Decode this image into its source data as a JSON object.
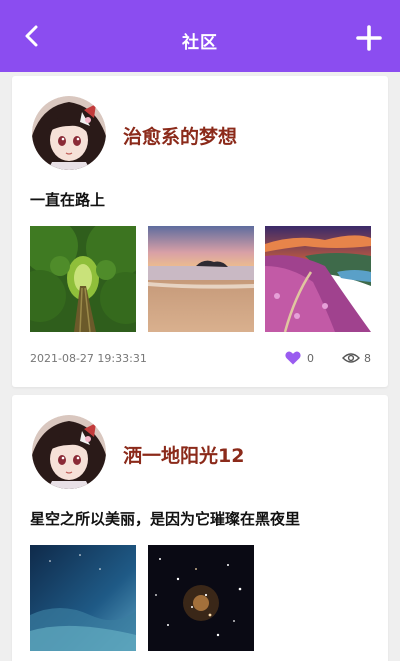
{
  "header": {
    "title": "社区",
    "back_icon": "chevron-left-icon",
    "add_icon": "plus-icon",
    "background_color": "#8b4df0"
  },
  "posts": [
    {
      "username": "治愈系的梦想",
      "text": "一直在路上",
      "timestamp": "2021-08-27 19:33:31",
      "likes": "0",
      "views": "8",
      "images": [
        "green-tree-tunnel",
        "sunset-beach",
        "flower-hill-river"
      ]
    },
    {
      "username": "洒一地阳光12",
      "text": "星空之所以美丽，是因为它璀璨在黑夜里",
      "images": [
        "blue-night-sky",
        "starry-galaxy"
      ]
    }
  ],
  "colors": {
    "username": "#8b2a1a",
    "like_heart": "#9a5cf0"
  }
}
